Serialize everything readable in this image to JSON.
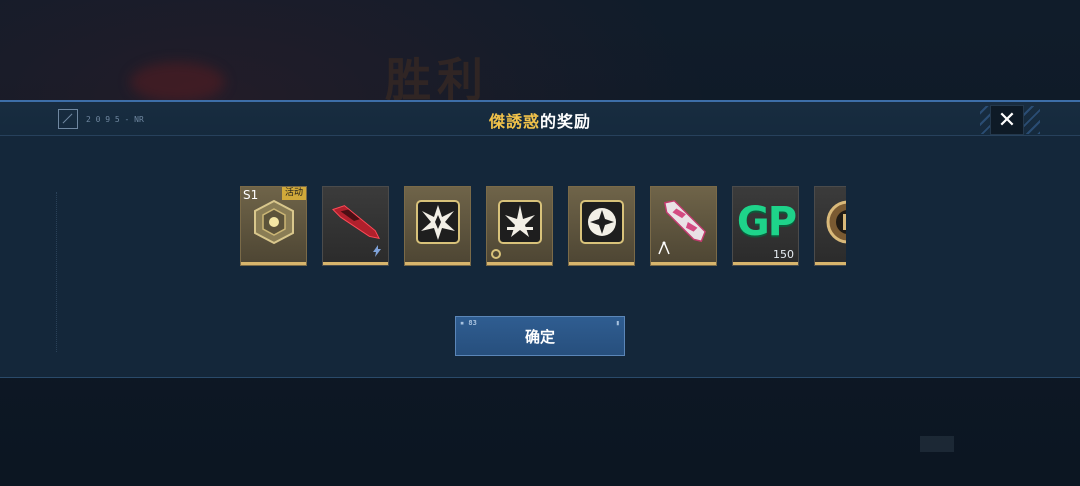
{
  "background": {
    "title": "胜利"
  },
  "modal": {
    "title_name": "傑誘惑",
    "title_suffix": "的奖励",
    "header_code": "2 0 9 5 - NR",
    "confirm_label": "确定",
    "close_icon": "close-icon"
  },
  "rewards": [
    {
      "icon": "crate-icon",
      "season_label": "S1",
      "event_tag": "活动",
      "style": "gold"
    },
    {
      "icon": "weapon-skin-red-icon",
      "style": "dark"
    },
    {
      "icon": "emblem-burst-icon",
      "style": "gold"
    },
    {
      "icon": "emblem-wings-icon",
      "style": "gold"
    },
    {
      "icon": "emblem-compass-icon",
      "style": "gold"
    },
    {
      "icon": "weapon-skin-pink-icon",
      "style": "gold"
    },
    {
      "icon": "gp-currency-icon",
      "gp_text": "GP",
      "quantity": "150",
      "style": "dark"
    },
    {
      "icon": "medal-icon",
      "style": "dark"
    }
  ],
  "colors": {
    "accent_gold": "#f1c24a",
    "button_blue": "#2f5d91",
    "gp_green": "#1ed38a"
  }
}
